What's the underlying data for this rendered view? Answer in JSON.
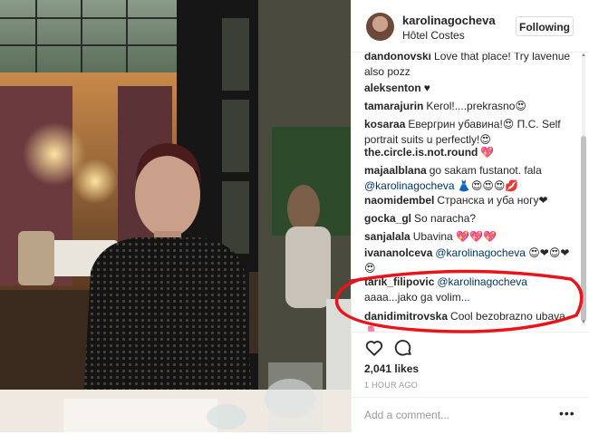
{
  "post": {
    "username": "karolinagocheva",
    "location": "Hôtel Costes",
    "follow_label": "Following"
  },
  "comments": [
    {
      "user": "dandonovski",
      "text": "Love that place! Try lavenue also pozz"
    },
    {
      "user": "aleksenton",
      "text": "♥"
    },
    {
      "user": "tamarajurin",
      "text": "Kerol!....prekrasno😍"
    },
    {
      "user": "kosaraa",
      "text": "Евергрин убавина!😍 П.С. Self portrait suits u perfectly!😍"
    },
    {
      "user": "the.circle.is.not.round",
      "text": "💖"
    },
    {
      "user": "majaalblana",
      "pre": "go sakam fustanot. fala ",
      "mention": "@karolinagocheva",
      "post": " 👗😍😍😍💋"
    },
    {
      "user": "naomidembel",
      "text": "Странска и уба ногу❤"
    },
    {
      "user": "gocka_gl",
      "text": "So naracha?"
    },
    {
      "user": "sanjalala",
      "text": "Ubavina 💖💖💖"
    },
    {
      "user": "ivananolceva",
      "pre": "",
      "mention": "@karolinagocheva",
      "post": " 😍❤😍❤ 😍"
    },
    {
      "user": "tarik_filipovic",
      "pre": "",
      "mention": "@karolinagocheva",
      "post": " aaaa...jako ga volim..."
    },
    {
      "user": "danidimitrovska",
      "text": "Cool bezobrazno ubava 🌷"
    }
  ],
  "actions": {
    "likes": "2,041 likes",
    "time": "1 HOUR AGO",
    "comment_placeholder": "Add a comment...",
    "more": "•••"
  },
  "colors": {
    "annotation": "#e8141b",
    "mention": "#003569"
  }
}
